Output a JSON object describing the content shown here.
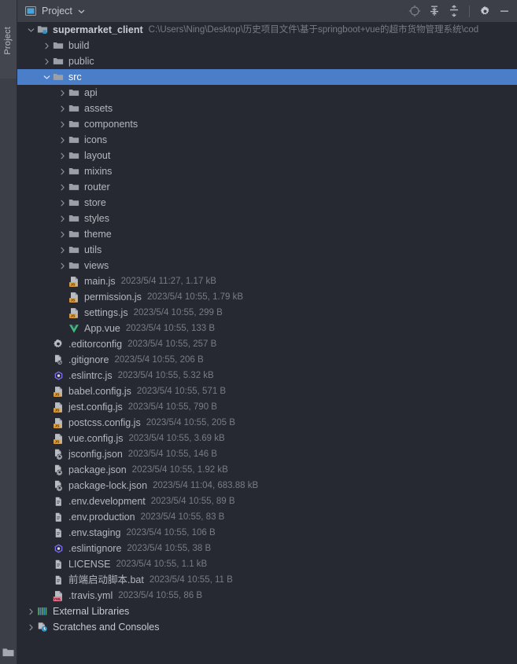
{
  "rail": {
    "tab_label": "Project",
    "folder_icon": "folder-icon"
  },
  "toolbar": {
    "title": "Project",
    "dropdown_icon": "chevron-down-icon",
    "project_view_icon": "project-view-icon",
    "buttons": [
      {
        "name": "locate-icon",
        "tooltip": "Select Opened File"
      },
      {
        "name": "expand-all-icon",
        "tooltip": "Expand All"
      },
      {
        "name": "collapse-all-icon",
        "tooltip": "Collapse All"
      },
      {
        "name": "settings-gear-icon",
        "tooltip": "Settings"
      },
      {
        "name": "hide-icon",
        "tooltip": "Hide"
      }
    ]
  },
  "tree": {
    "rows": [
      {
        "depth": 0,
        "arrow": "down",
        "icon": "module-folder-icon",
        "label": "supermarket_client",
        "bold": true,
        "meta": "C:\\Users\\Ning\\Desktop\\历史项目文件\\基于springboot+vue的超市货物管理系统\\cod"
      },
      {
        "depth": 1,
        "arrow": "right",
        "icon": "folder-icon",
        "label": "build",
        "meta": ""
      },
      {
        "depth": 1,
        "arrow": "right",
        "icon": "folder-icon",
        "label": "public",
        "meta": ""
      },
      {
        "depth": 1,
        "arrow": "down",
        "icon": "folder-icon",
        "label": "src",
        "meta": "",
        "selected": true
      },
      {
        "depth": 2,
        "arrow": "right",
        "icon": "folder-icon",
        "label": "api",
        "meta": ""
      },
      {
        "depth": 2,
        "arrow": "right",
        "icon": "folder-icon",
        "label": "assets",
        "meta": ""
      },
      {
        "depth": 2,
        "arrow": "right",
        "icon": "folder-icon",
        "label": "components",
        "meta": ""
      },
      {
        "depth": 2,
        "arrow": "right",
        "icon": "folder-icon",
        "label": "icons",
        "meta": ""
      },
      {
        "depth": 2,
        "arrow": "right",
        "icon": "folder-icon",
        "label": "layout",
        "meta": ""
      },
      {
        "depth": 2,
        "arrow": "right",
        "icon": "folder-icon",
        "label": "mixins",
        "meta": ""
      },
      {
        "depth": 2,
        "arrow": "right",
        "icon": "folder-icon",
        "label": "router",
        "meta": ""
      },
      {
        "depth": 2,
        "arrow": "right",
        "icon": "folder-icon",
        "label": "store",
        "meta": ""
      },
      {
        "depth": 2,
        "arrow": "right",
        "icon": "folder-icon",
        "label": "styles",
        "meta": ""
      },
      {
        "depth": 2,
        "arrow": "right",
        "icon": "folder-icon",
        "label": "theme",
        "meta": ""
      },
      {
        "depth": 2,
        "arrow": "right",
        "icon": "folder-icon",
        "label": "utils",
        "meta": ""
      },
      {
        "depth": 2,
        "arrow": "right",
        "icon": "folder-icon",
        "label": "views",
        "meta": ""
      },
      {
        "depth": 2,
        "arrow": "none",
        "icon": "js-file-icon",
        "label": "main.js",
        "meta": "2023/5/4 11:27, 1.17 kB"
      },
      {
        "depth": 2,
        "arrow": "none",
        "icon": "js-file-icon",
        "label": "permission.js",
        "meta": "2023/5/4 10:55, 1.79 kB"
      },
      {
        "depth": 2,
        "arrow": "none",
        "icon": "js-file-icon",
        "label": "settings.js",
        "meta": "2023/5/4 10:55, 299 B"
      },
      {
        "depth": 2,
        "arrow": "none",
        "icon": "vue-file-icon",
        "label": "App.vue",
        "meta": "2023/5/4 10:55, 133 B"
      },
      {
        "depth": 1,
        "arrow": "none",
        "icon": "gear-file-icon",
        "label": ".editorconfig",
        "meta": "2023/5/4 10:55, 257 B"
      },
      {
        "depth": 1,
        "arrow": "none",
        "icon": "ignore-file-icon",
        "label": ".gitignore",
        "meta": "2023/5/4 10:55, 206 B"
      },
      {
        "depth": 1,
        "arrow": "none",
        "icon": "eslint-file-icon",
        "label": ".eslintrc.js",
        "meta": "2023/5/4 10:55, 5.32 kB"
      },
      {
        "depth": 1,
        "arrow": "none",
        "icon": "js-file-icon",
        "label": "babel.config.js",
        "meta": "2023/5/4 10:55, 571 B"
      },
      {
        "depth": 1,
        "arrow": "none",
        "icon": "js-file-icon",
        "label": "jest.config.js",
        "meta": "2023/5/4 10:55, 790 B"
      },
      {
        "depth": 1,
        "arrow": "none",
        "icon": "js-file-icon",
        "label": "postcss.config.js",
        "meta": "2023/5/4 10:55, 205 B"
      },
      {
        "depth": 1,
        "arrow": "none",
        "icon": "js-file-icon",
        "label": "vue.config.js",
        "meta": "2023/5/4 10:55, 3.69 kB"
      },
      {
        "depth": 1,
        "arrow": "none",
        "icon": "json-file-icon",
        "label": "jsconfig.json",
        "meta": "2023/5/4 10:55, 146 B"
      },
      {
        "depth": 1,
        "arrow": "none",
        "icon": "json-file-icon",
        "label": "package.json",
        "meta": "2023/5/4 10:55, 1.92 kB"
      },
      {
        "depth": 1,
        "arrow": "none",
        "icon": "json-file-icon",
        "label": "package-lock.json",
        "meta": "2023/5/4 11:04, 683.88 kB"
      },
      {
        "depth": 1,
        "arrow": "none",
        "icon": "text-file-icon",
        "label": ".env.development",
        "meta": "2023/5/4 10:55, 89 B"
      },
      {
        "depth": 1,
        "arrow": "none",
        "icon": "text-file-icon",
        "label": ".env.production",
        "meta": "2023/5/4 10:55, 83 B"
      },
      {
        "depth": 1,
        "arrow": "none",
        "icon": "text-file-icon",
        "label": ".env.staging",
        "meta": "2023/5/4 10:55, 106 B"
      },
      {
        "depth": 1,
        "arrow": "none",
        "icon": "eslint-file-icon",
        "label": ".eslintignore",
        "meta": "2023/5/4 10:55, 38 B"
      },
      {
        "depth": 1,
        "arrow": "none",
        "icon": "text-file-icon",
        "label": "LICENSE",
        "meta": "2023/5/4 10:55, 1.1 kB"
      },
      {
        "depth": 1,
        "arrow": "none",
        "icon": "text-file-icon",
        "label": "前端启动脚本.bat",
        "meta": "2023/5/4 10:55, 11 B"
      },
      {
        "depth": 1,
        "arrow": "none",
        "icon": "yml-file-icon",
        "label": ".travis.yml",
        "meta": "2023/5/4 10:55, 86 B"
      },
      {
        "depth": 0,
        "arrow": "right",
        "icon": "libraries-icon",
        "label": "External Libraries",
        "meta": "",
        "white": true
      },
      {
        "depth": 0,
        "arrow": "right",
        "icon": "scratches-icon",
        "label": "Scratches and Consoles",
        "meta": "",
        "white": true
      }
    ]
  },
  "colors": {
    "background": "#262932",
    "toolbar_background": "#3c3f48",
    "selection_blue": "#4b7ec9",
    "text": "#b4b7bd",
    "meta_text": "#787c85",
    "folder_icon": "#9aa0a6",
    "js_badge": "#e8a33d",
    "vue_green": "#41b883",
    "eslint_purple": "#7b68ee",
    "yml_badge": "#e87a90"
  }
}
